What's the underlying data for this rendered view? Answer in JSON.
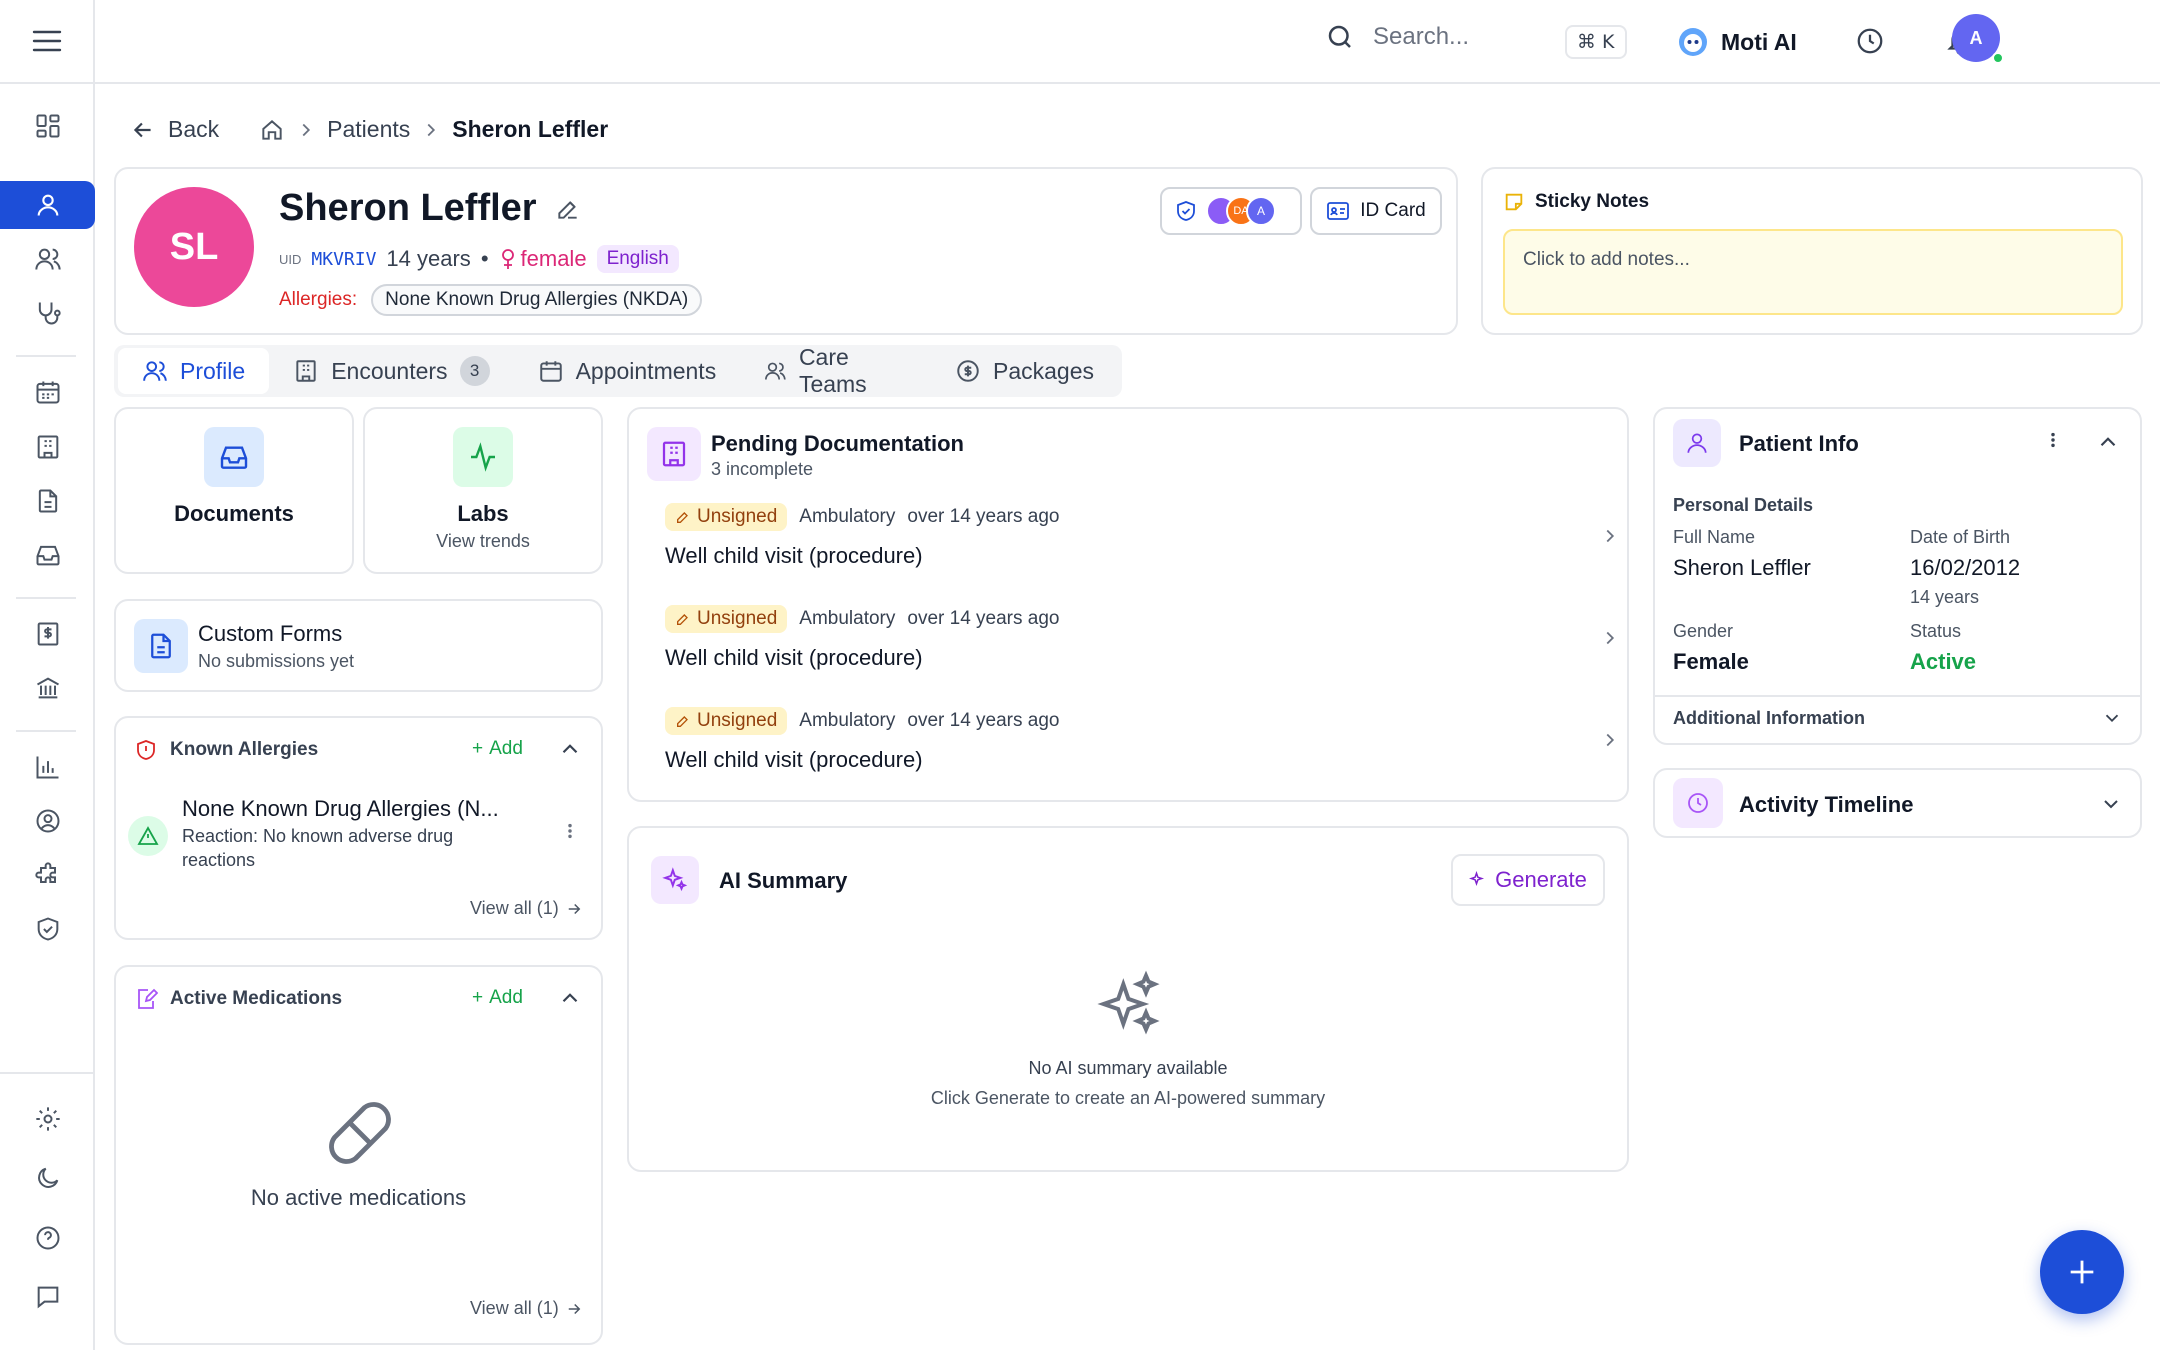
{
  "topbar": {
    "search_placeholder": "Search...",
    "shortcut": "⌘ K",
    "assistant": "Moti AI",
    "user_initial": "A"
  },
  "breadcrumb": {
    "back": "Back",
    "patients": "Patients",
    "current": "Sheron Leffler"
  },
  "patient": {
    "initials": "SL",
    "name": "Sheron Leffler",
    "uid_label": "UID",
    "uid": "MKVRIV",
    "age": "14 years",
    "gender": "female",
    "language": "English",
    "allergies_label": "Allergies:",
    "allergy": "None Known Drug Allergies (NKDA)",
    "id_card": "ID Card",
    "team_avatars": [
      "",
      "DA",
      "A"
    ]
  },
  "sticky": {
    "title": "Sticky Notes",
    "placeholder": "Click to add notes..."
  },
  "tabs": [
    {
      "label": "Profile"
    },
    {
      "label": "Encounters",
      "badge": "3"
    },
    {
      "label": "Appointments"
    },
    {
      "label": "Care Teams"
    },
    {
      "label": "Packages"
    }
  ],
  "documents": {
    "label": "Documents"
  },
  "labs": {
    "label": "Labs",
    "sub": "View trends"
  },
  "custom_forms": {
    "title": "Custom Forms",
    "sub": "No submissions yet"
  },
  "known_allergies": {
    "title": "Known Allergies",
    "add": "Add",
    "item_title": "None Known Drug Allergies (N...",
    "item_reaction": "Reaction: No known adverse drug reactions",
    "view_all": "View all (1)"
  },
  "medications": {
    "title": "Active Medications",
    "add": "Add",
    "empty": "No active medications",
    "view_all": "View all (1)"
  },
  "pending": {
    "title": "Pending Documentation",
    "sub": "3 incomplete",
    "items": [
      {
        "status": "Unsigned",
        "type": "Ambulatory",
        "time": "over 14 years ago",
        "title": "Well child visit (procedure)"
      },
      {
        "status": "Unsigned",
        "type": "Ambulatory",
        "time": "over 14 years ago",
        "title": "Well child visit (procedure)"
      },
      {
        "status": "Unsigned",
        "type": "Ambulatory",
        "time": "over 14 years ago",
        "title": "Well child visit (procedure)"
      }
    ]
  },
  "ai": {
    "title": "AI Summary",
    "generate": "Generate",
    "empty_title": "No AI summary available",
    "empty_sub": "Click Generate to create an AI-powered summary"
  },
  "patient_info": {
    "title": "Patient Info",
    "section": "Personal Details",
    "full_name_label": "Full Name",
    "full_name": "Sheron Leffler",
    "dob_label": "Date of Birth",
    "dob": "16/02/2012",
    "dob_age": "14 years",
    "gender_label": "Gender",
    "gender": "Female",
    "status_label": "Status",
    "status": "Active",
    "additional": "Additional Information"
  },
  "timeline": {
    "title": "Activity Timeline"
  },
  "colors": {
    "primary": "#1d4ed8",
    "avatar": "#ec4899",
    "green": "#16a34a",
    "purple": "#7c3aed",
    "danger": "#dc2626",
    "sticky_bg": "#fefce8"
  }
}
